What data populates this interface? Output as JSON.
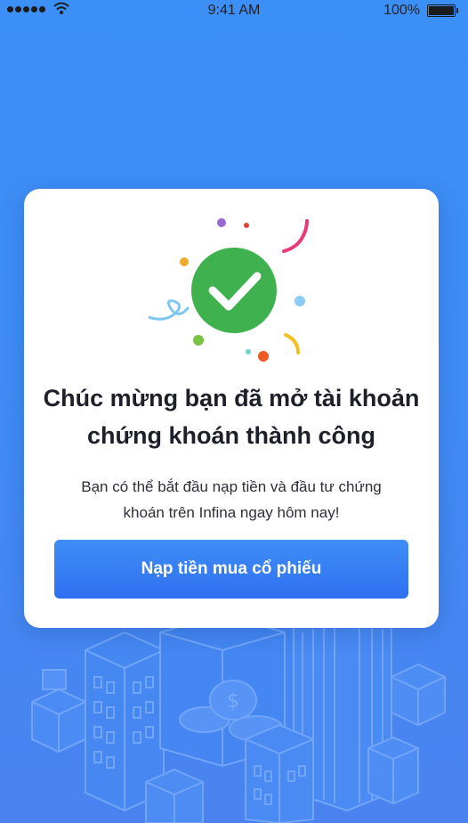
{
  "status_bar": {
    "time": "9:41 AM",
    "battery": "100%",
    "signal_icon": "signal-dots-icon",
    "wifi_icon": "wifi-icon",
    "battery_icon": "battery-icon"
  },
  "success_dialog": {
    "icon": "checkmark-circle-icon",
    "title": "Chúc mừng bạn đã mở tài khoản chứng khoán thành công",
    "message": "Bạn có thể bắt đầu nạp tiền và đầu tư chứng khoán trên Infina ngay hôm nay!",
    "cta_label": "Nạp tiền mua cổ phiếu"
  },
  "colors": {
    "background": "#3f8cf4",
    "card": "#ffffff",
    "success_green": "#3fb24f",
    "button": "#3479f2",
    "title_text": "#1d1f2a"
  },
  "background_illustration": "city-buildings-coins-illustration"
}
